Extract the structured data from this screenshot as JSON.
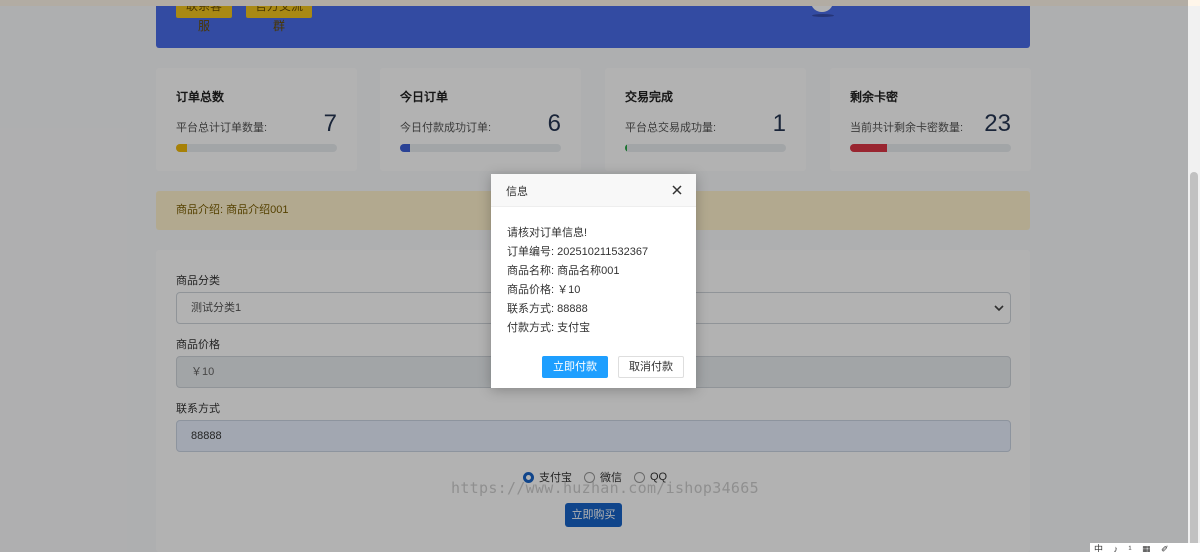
{
  "banner": {
    "buttons": [
      "联系客服",
      "官方交流群"
    ]
  },
  "stats": [
    {
      "title": "订单总数",
      "label": "平台总计订单数量:",
      "value": "7",
      "fill": 0.07,
      "color": "#f0b90b"
    },
    {
      "title": "今日订单",
      "label": "今日付款成功订单:",
      "value": "6",
      "fill": 0.06,
      "color": "#3d5fd6"
    },
    {
      "title": "交易完成",
      "label": "平台总交易成功量:",
      "value": "1",
      "fill": 0.01,
      "color": "#28a745"
    },
    {
      "title": "剩余卡密",
      "label": "当前共计剩余卡密数量:",
      "value": "23",
      "fill": 0.23,
      "color": "#dc3545"
    }
  ],
  "notice": "商品介绍: 商品介绍001",
  "form": {
    "category_label": "商品分类",
    "category_value": "测试分类1",
    "price_label": "商品价格",
    "price_value": "￥10",
    "contact_label": "联系方式",
    "contact_value": "88888",
    "payments": [
      {
        "label": "支付宝",
        "checked": true
      },
      {
        "label": "微信",
        "checked": false
      },
      {
        "label": "QQ",
        "checked": false
      }
    ],
    "buy_label": "立即购买"
  },
  "watermark": "https://www.huzhan.com/ishop34665",
  "dialog": {
    "title": "信息",
    "lines": [
      "请核对订单信息!",
      "订单编号: 202510211532367",
      "商品名称: 商品名称001",
      "商品价格: ￥10",
      "联系方式: 88888",
      "付款方式: 支付宝"
    ],
    "pay_label": "立即付款",
    "cancel_label": "取消付款"
  },
  "tray": "中 ♪ ¹ ▦ ✐"
}
